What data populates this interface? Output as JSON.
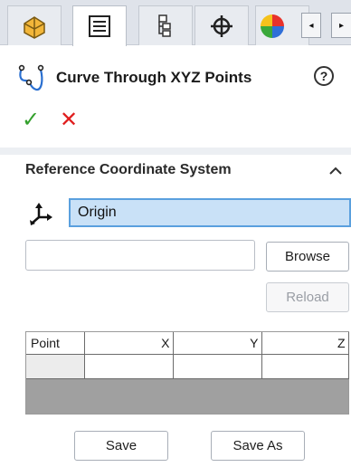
{
  "tabs": [
    {
      "name": "feature-manager",
      "active": false
    },
    {
      "name": "property-manager",
      "active": true
    },
    {
      "name": "configuration-manager",
      "active": false
    },
    {
      "name": "dimxpert-manager",
      "active": false
    },
    {
      "name": "display-manager",
      "active": false
    }
  ],
  "scroll": {
    "left": "◂",
    "right": "▸"
  },
  "header": {
    "title": "Curve Through XYZ Points",
    "help": "?",
    "ok": "✓",
    "cancel": "✕"
  },
  "reference_cs": {
    "title": "Reference Coordinate System",
    "value": "Origin"
  },
  "file": {
    "path_value": "",
    "browse_label": "Browse",
    "reload_label": "Reload"
  },
  "table": {
    "columns": [
      "Point",
      "X",
      "Y",
      "Z"
    ],
    "rows": [
      [
        "",
        "",
        "",
        ""
      ]
    ]
  },
  "actions": {
    "save_label": "Save",
    "save_as_label": "Save As"
  },
  "colors": {
    "ok": "#33a02c",
    "cancel": "#e01e1e",
    "selection_fill": "#c9e1f7",
    "selection_border": "#5aa0de"
  }
}
